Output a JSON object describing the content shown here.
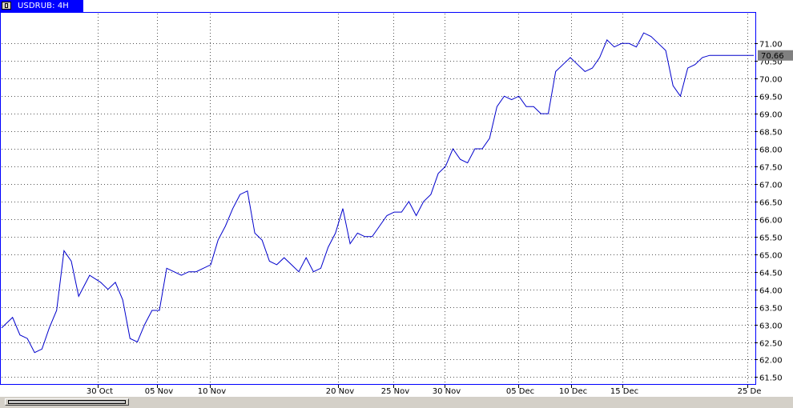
{
  "window": {
    "tab_title": "USDRUB: 4H"
  },
  "colors": {
    "line": "#0000cc",
    "frame": "#0000ff",
    "grid": "#555555",
    "price_badge_bg": "#808080",
    "price_badge_text": "#ffffff"
  },
  "chart_data": {
    "type": "line",
    "title": "USDRUB: 4H",
    "current_price_label": "70.66",
    "xlabel": "",
    "ylabel": "",
    "ylim": [
      61.35,
      71.85
    ],
    "y_ticks": [
      61.5,
      62.0,
      62.5,
      63.0,
      63.5,
      64.0,
      64.5,
      65.0,
      65.5,
      66.0,
      66.5,
      67.0,
      67.5,
      68.0,
      68.5,
      69.0,
      69.5,
      70.0,
      70.5,
      71.0
    ],
    "y_tick_labels": [
      "61.50",
      "62.00",
      "62.50",
      "63.00",
      "63.50",
      "64.00",
      "64.50",
      "65.00",
      "65.50",
      "66.00",
      "66.50",
      "67.00",
      "67.50",
      "68.00",
      "68.50",
      "69.00",
      "69.50",
      "70.00",
      "70.50",
      "71.00"
    ],
    "x_ticks": [
      "30 Oct",
      "05 Nov",
      "10 Nov",
      "20 Nov",
      "25 Nov",
      "30 Nov",
      "05 Dec",
      "10 Dec",
      "15 Dec",
      "25 De"
    ],
    "x_tick_positions": [
      26.3,
      42.4,
      56.7,
      91.7,
      106.8,
      120.8,
      140.9,
      155.3,
      169.1,
      203.3
    ],
    "x_range": [
      0,
      205
    ],
    "series": [
      {
        "name": "",
        "x": [
          0,
          3,
          5,
          7,
          9,
          11,
          13,
          15,
          17,
          19,
          21,
          24,
          27,
          29,
          31,
          33,
          35,
          37,
          39,
          41,
          43,
          45,
          47,
          49,
          51,
          53,
          55,
          57,
          59,
          61,
          63,
          65,
          67,
          69,
          71,
          73,
          75,
          77,
          79,
          81,
          83,
          85,
          87,
          89,
          91,
          93,
          95,
          97,
          99,
          101,
          103,
          105,
          107,
          109,
          111,
          113,
          115,
          117,
          119,
          121,
          123,
          125,
          127,
          129,
          131,
          133,
          135,
          137,
          139,
          141,
          143,
          145,
          147,
          149,
          151,
          153,
          155,
          157,
          159,
          161,
          163,
          165,
          167,
          169,
          171,
          173,
          175,
          177,
          179,
          181,
          183,
          185,
          187,
          189,
          191,
          193,
          195,
          197,
          199,
          201,
          203,
          205
        ],
        "values": [
          62.9,
          63.2,
          62.7,
          62.6,
          62.2,
          62.3,
          62.9,
          63.4,
          65.1,
          64.8,
          63.8,
          64.4,
          64.2,
          64.0,
          64.2,
          63.7,
          62.6,
          62.5,
          63.0,
          63.4,
          63.4,
          64.6,
          64.5,
          64.4,
          64.5,
          64.5,
          64.6,
          64.7,
          65.4,
          65.8,
          66.3,
          66.7,
          66.8,
          65.6,
          65.4,
          64.8,
          64.7,
          64.9,
          64.7,
          64.5,
          64.9,
          64.5,
          64.6,
          65.2,
          65.6,
          66.3,
          65.3,
          65.6,
          65.5,
          65.5,
          65.8,
          66.1,
          66.2,
          66.2,
          66.5,
          66.1,
          66.5,
          66.7,
          67.3,
          67.5,
          68.0,
          67.7,
          67.6,
          68.0,
          68.0,
          68.3,
          69.2,
          69.5,
          69.4,
          69.5,
          69.2,
          69.2,
          69.0,
          69.0,
          70.2,
          70.4,
          70.6,
          70.4,
          70.2,
          70.3,
          70.6,
          71.1,
          70.9,
          71.0,
          71.0,
          70.9,
          71.3,
          71.2,
          71.0,
          70.8,
          69.8,
          69.5,
          70.3,
          70.4,
          70.6,
          70.66,
          70.66,
          70.66,
          70.66,
          70.66,
          70.66,
          70.66
        ]
      }
    ],
    "grid": true,
    "legend": "none"
  }
}
